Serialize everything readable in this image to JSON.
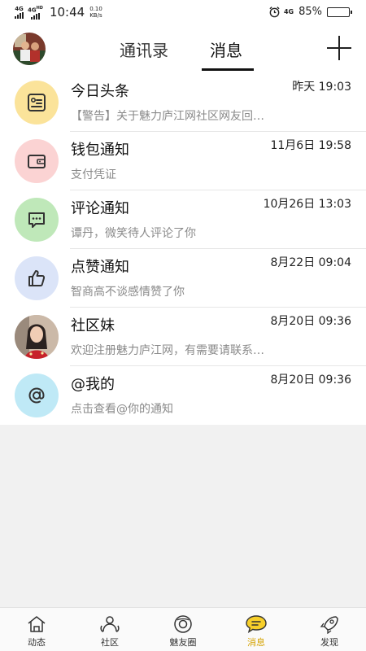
{
  "status_bar": {
    "sim1": "4G",
    "sim2": "4G",
    "sim2_sup": "HD",
    "time": "10:44",
    "speed_value": "0.10",
    "speed_unit": "KB/s",
    "network": "4G",
    "battery_text": "85%",
    "battery_level": 0.85
  },
  "header": {
    "tabs": [
      "通讯录",
      "消息"
    ],
    "active_tab": "消息"
  },
  "messages": [
    {
      "title": "今日头条",
      "time": "昨天 19:03",
      "preview": "【警告】关于魅力庐江网社区网友回…",
      "icon": "news-icon",
      "icon_bg": "#fbe39a"
    },
    {
      "title": "钱包通知",
      "time": "11月6日 19:58",
      "preview": "支付凭证",
      "icon": "wallet-icon",
      "icon_bg": "#fbd3d3"
    },
    {
      "title": "评论通知",
      "time": "10月26日 13:03",
      "preview": "谭丹，微笑待人评论了你",
      "icon": "comment-icon",
      "icon_bg": "#bfe8b9"
    },
    {
      "title": "点赞通知",
      "time": "8月22日 09:04",
      "preview": "智商高不谈感情赞了你",
      "icon": "thumbs-up-icon",
      "icon_bg": "#dbe4f8"
    },
    {
      "title": "社区妹",
      "time": "8月20日 09:36",
      "preview": "欢迎注册魅力庐江网，有需要请联系…",
      "icon": "avatar",
      "icon_bg": "#d9c7b8"
    },
    {
      "title": "@我的",
      "time": "8月20日 09:36",
      "preview": "点击查看@你的通知",
      "icon": "at-icon",
      "icon_bg": "#bfe9f6"
    }
  ],
  "bottom_nav": [
    {
      "label": "动态",
      "icon": "home-icon"
    },
    {
      "label": "社区",
      "icon": "community-icon"
    },
    {
      "label": "魅友圈",
      "icon": "circle-icon"
    },
    {
      "label": "消息",
      "icon": "message-icon",
      "active": true
    },
    {
      "label": "发现",
      "icon": "rocket-icon"
    }
  ],
  "colors": {
    "accent": "#f7cf2a",
    "active_label": "#d4a200"
  }
}
